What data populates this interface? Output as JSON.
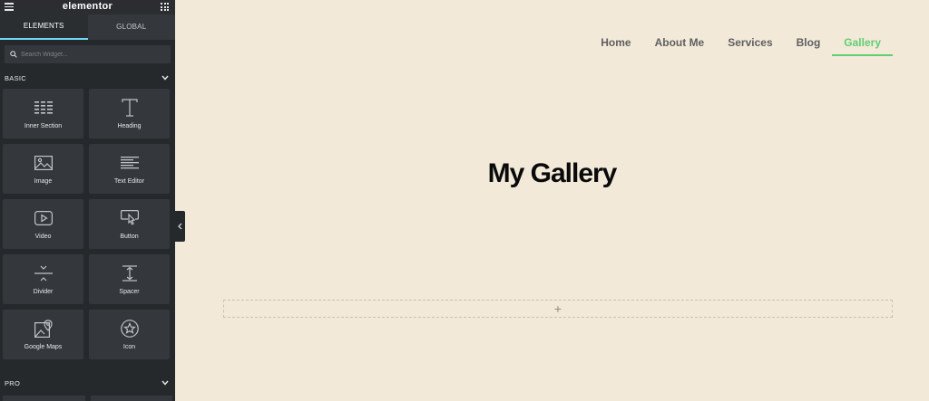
{
  "app": {
    "logo": "elementor",
    "brand_color": "#71d7f7"
  },
  "sidebar": {
    "tabs": [
      {
        "label": "ELEMENTS",
        "active": true
      },
      {
        "label": "GLOBAL",
        "active": false
      }
    ],
    "search": {
      "placeholder": "Search Widget..."
    },
    "sections": {
      "basic": {
        "label": "BASIC"
      },
      "pro": {
        "label": "PRO"
      }
    },
    "widgets": [
      {
        "label": "Inner Section",
        "icon": "inner-section-icon"
      },
      {
        "label": "Heading",
        "icon": "heading-icon"
      },
      {
        "label": "Image",
        "icon": "image-icon"
      },
      {
        "label": "Text Editor",
        "icon": "text-editor-icon"
      },
      {
        "label": "Video",
        "icon": "video-icon"
      },
      {
        "label": "Button",
        "icon": "button-icon"
      },
      {
        "label": "Divider",
        "icon": "divider-icon"
      },
      {
        "label": "Spacer",
        "icon": "spacer-icon"
      },
      {
        "label": "Google Maps",
        "icon": "google-maps-icon"
      },
      {
        "label": "Icon",
        "icon": "star-icon"
      }
    ]
  },
  "page": {
    "nav": [
      {
        "label": "Home",
        "active": false
      },
      {
        "label": "About Me",
        "active": false
      },
      {
        "label": "Services",
        "active": false
      },
      {
        "label": "Blog",
        "active": false
      },
      {
        "label": "Gallery",
        "active": true
      }
    ],
    "nav_active_color": "#61ce70",
    "title": "My Gallery",
    "add_section_symbol": "+",
    "background": "#f2e9d9"
  }
}
